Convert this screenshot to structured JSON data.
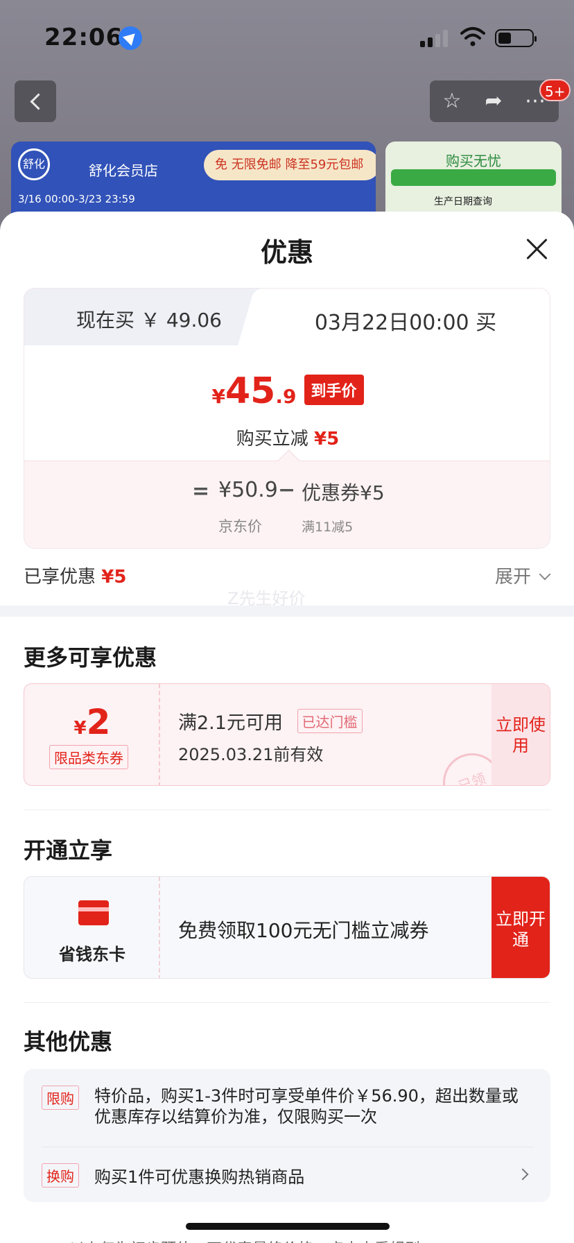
{
  "status_bar": {
    "time": "22:06"
  },
  "top_bar": {
    "notification_badge": "5+"
  },
  "background_banners": {
    "store_logo": "舒化",
    "store_name": "舒化会员店",
    "promo_free": "免 无限免邮",
    "promo_discount": "降至59元包邮",
    "date_range": "3/16 00:00-3/23 23:59",
    "worry_free_title": "购买无忧",
    "production_date": "生产日期查询"
  },
  "sheet": {
    "title": "优惠",
    "tabs": {
      "now": "现在买 ￥ 49.06",
      "later": "03月22日00:00 买"
    },
    "final_price": {
      "currency": "¥",
      "integer": "45",
      "decimal": ".9",
      "tag": "到手价"
    },
    "instant_discount": {
      "label": "购买立减",
      "value": "¥5"
    },
    "calculation": {
      "equals": "=",
      "base_price": "¥50.9",
      "minus": "−",
      "coupon_value": "优惠券¥5",
      "base_label": "京东价",
      "coupon_label": "满11减5"
    },
    "enjoyed": {
      "label": "已享优惠",
      "value": "¥5"
    },
    "expand_label": "展开",
    "watermark": "Z先生好价"
  },
  "more_offers": {
    "title": "更多可享优惠",
    "coupon": {
      "currency": "¥",
      "amount": "2",
      "type": "限品类东券",
      "condition": "满2.1元可用",
      "status_flag": "已达门槛",
      "expiry": "2025.03.21前有效",
      "stamp": "已领",
      "button": "立即使用"
    }
  },
  "activate_offers": {
    "title": "开通立享",
    "card_name": "省钱东卡",
    "description": "免费领取100元无门槛立减券",
    "button": "立即开通"
  },
  "other_offers": {
    "title": "其他优惠",
    "items": [
      {
        "tag": "限购",
        "text": "特价品，购买1-3件时可享受单件价￥56.90，超出数量或优惠库存以结算价为准，仅限购买一次"
      },
      {
        "tag": "换购",
        "text": "购买1件可优惠换购热销商品"
      }
    ]
  },
  "footer_note": "以上仅为初步预估，不代表最终价格，点击查看规则"
}
